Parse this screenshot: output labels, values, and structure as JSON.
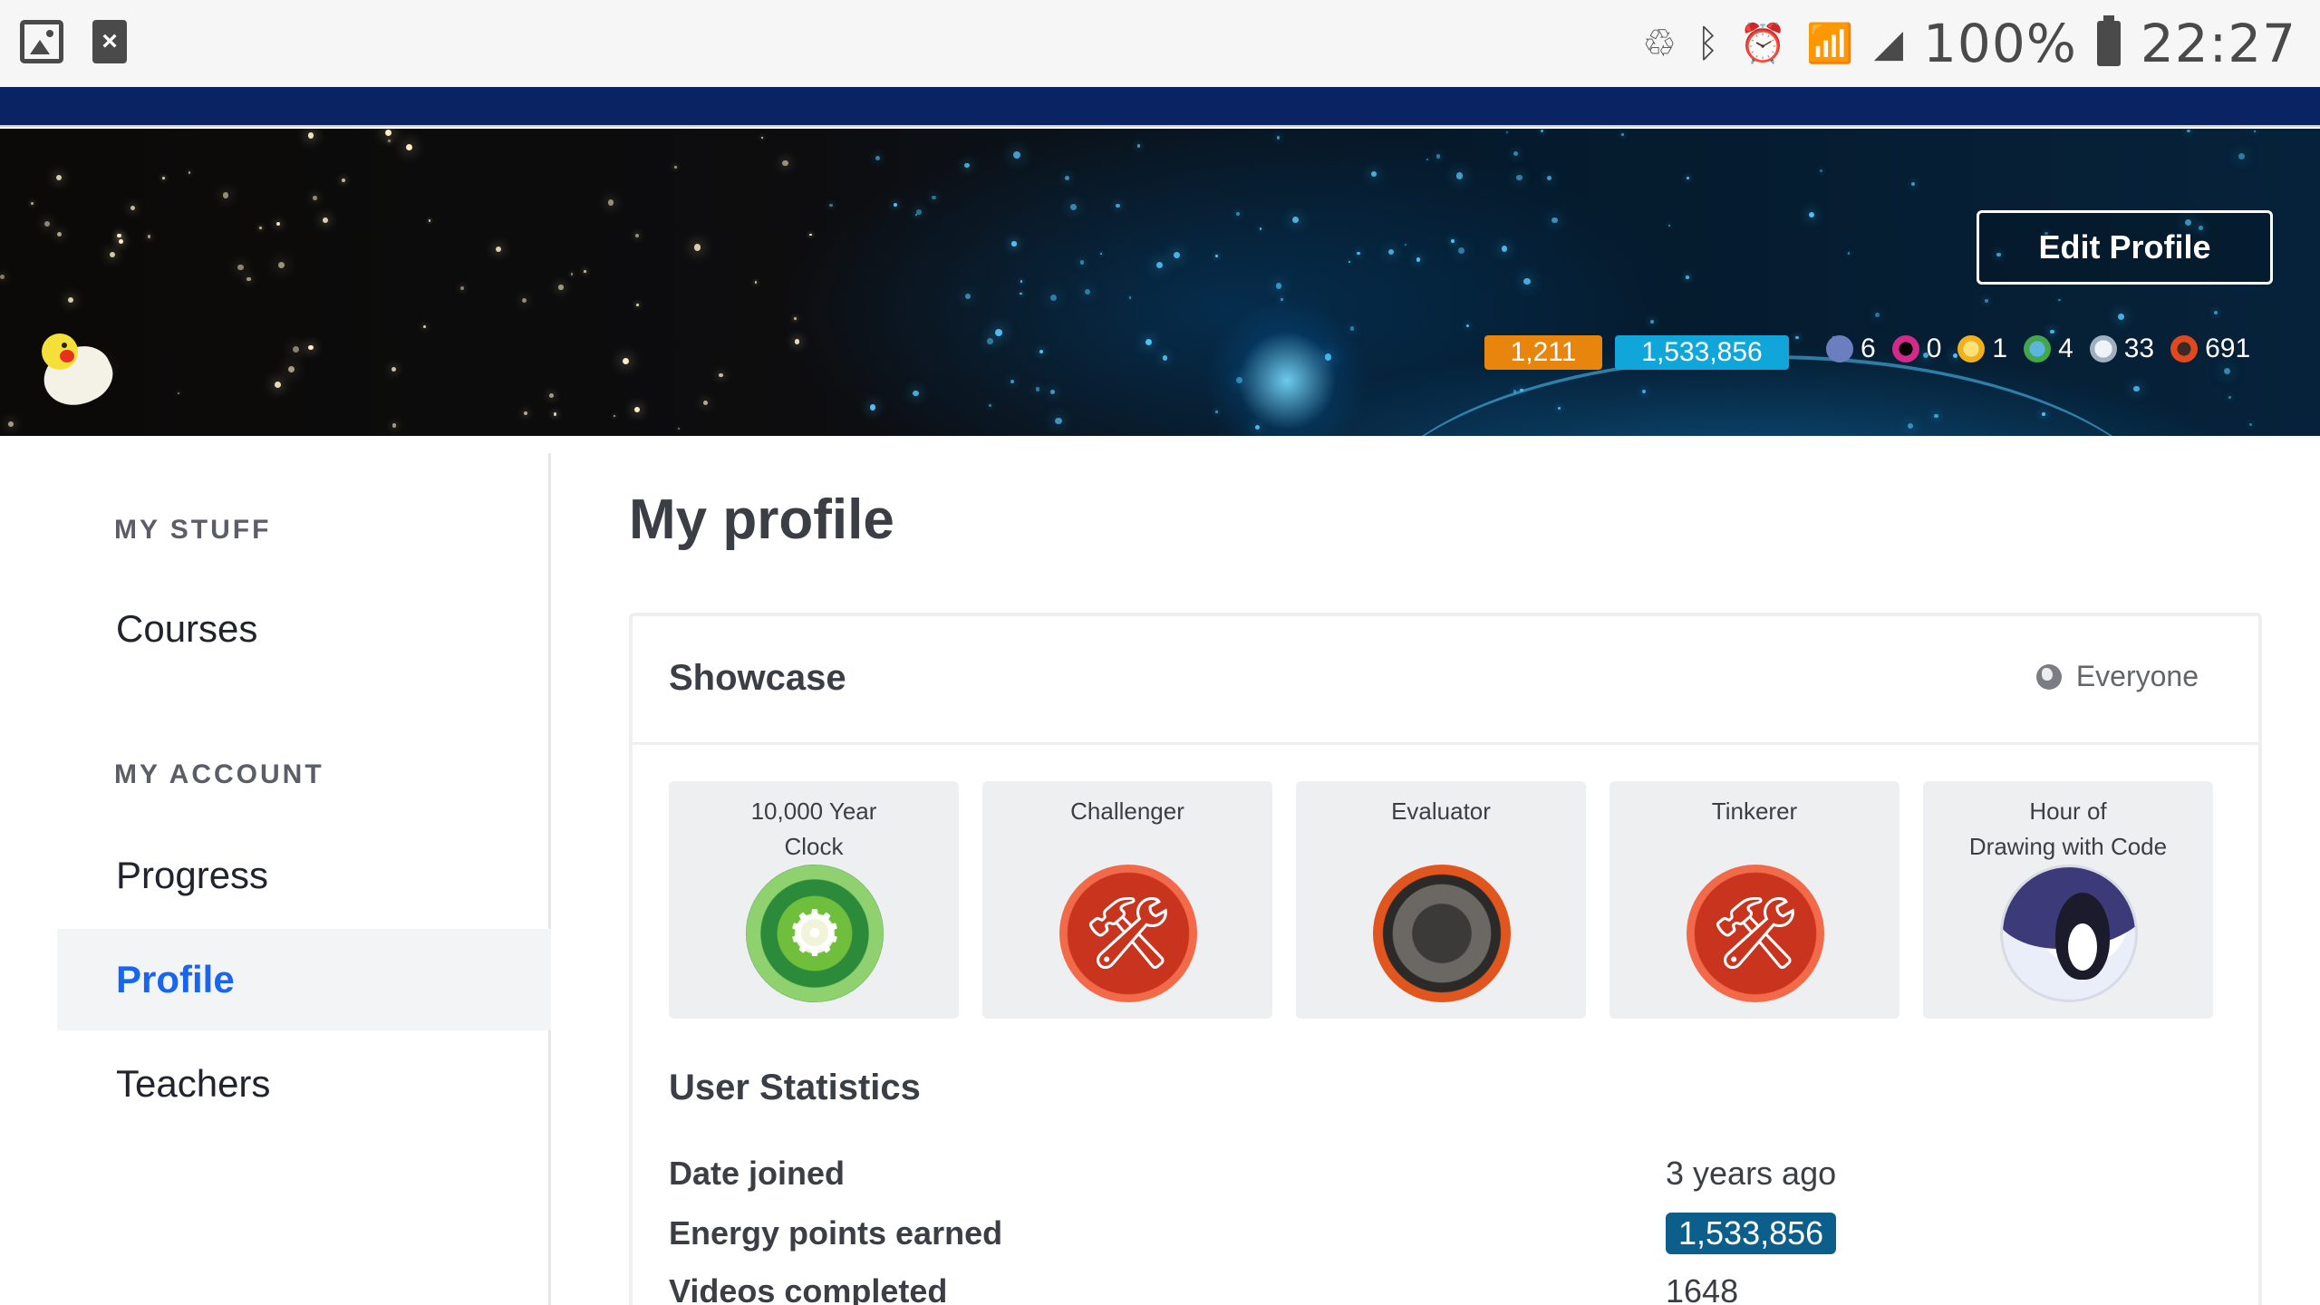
{
  "status_bar": {
    "left_icons": [
      "image-icon",
      "close-notification-icon"
    ],
    "right_icons": [
      "recycle-icon",
      "bluetooth-icon",
      "alarm-icon",
      "wifi-icon",
      "signal-icon"
    ],
    "battery_percent": "100%",
    "time": "22:27"
  },
  "banner": {
    "edit_profile_label": "Edit Profile",
    "points_orange": "1,211",
    "points_blue": "1,533,856",
    "badges": [
      {
        "icon": "challenge-patch-icon",
        "count": "6",
        "color": "#6b7fbf"
      },
      {
        "icon": "black-hole-badge-icon",
        "count": "0",
        "color": "#d12a8a"
      },
      {
        "icon": "sun-badge-icon",
        "count": "1",
        "color": "#f2c230"
      },
      {
        "icon": "earth-badge-icon",
        "count": "4",
        "color": "#41a74a"
      },
      {
        "icon": "moon-badge-icon",
        "count": "33",
        "color": "#c8d4de"
      },
      {
        "icon": "meteorite-badge-icon",
        "count": "691",
        "color": "#e0481d"
      }
    ]
  },
  "sidebar": {
    "section1": "MY STUFF",
    "courses": "Courses",
    "section2": "MY ACCOUNT",
    "progress": "Progress",
    "profile": "Profile",
    "teachers": "Teachers"
  },
  "main": {
    "title": "My profile",
    "showcase": {
      "title": "Showcase",
      "visibility": "Everyone",
      "tiles": [
        {
          "line1": "10,000 Year",
          "line2": "Clock",
          "icon": "gear-badge-icon"
        },
        {
          "line1": "Challenger",
          "line2": "",
          "icon": "tools-badge-icon"
        },
        {
          "line1": "Evaluator",
          "line2": "",
          "icon": "meteorite-badge-icon"
        },
        {
          "line1": "Tinkerer",
          "line2": "",
          "icon": "tools-badge-icon"
        },
        {
          "line1": "Hour of",
          "line2": "Drawing with Code",
          "icon": "penguin-badge-icon"
        }
      ]
    },
    "stats": {
      "title": "User Statistics",
      "rows": [
        {
          "label": "Date joined",
          "value": "3 years ago"
        },
        {
          "label": "Energy points earned",
          "value": "1,533,856"
        },
        {
          "label": "Videos completed",
          "value": "1648"
        }
      ]
    }
  },
  "colors": {
    "accent_blue": "#1865f2",
    "nav_strip": "#0a2463",
    "points_orange": "#e8850c",
    "points_blue": "#11a6d9",
    "energy_chip": "#0b5f8a"
  }
}
